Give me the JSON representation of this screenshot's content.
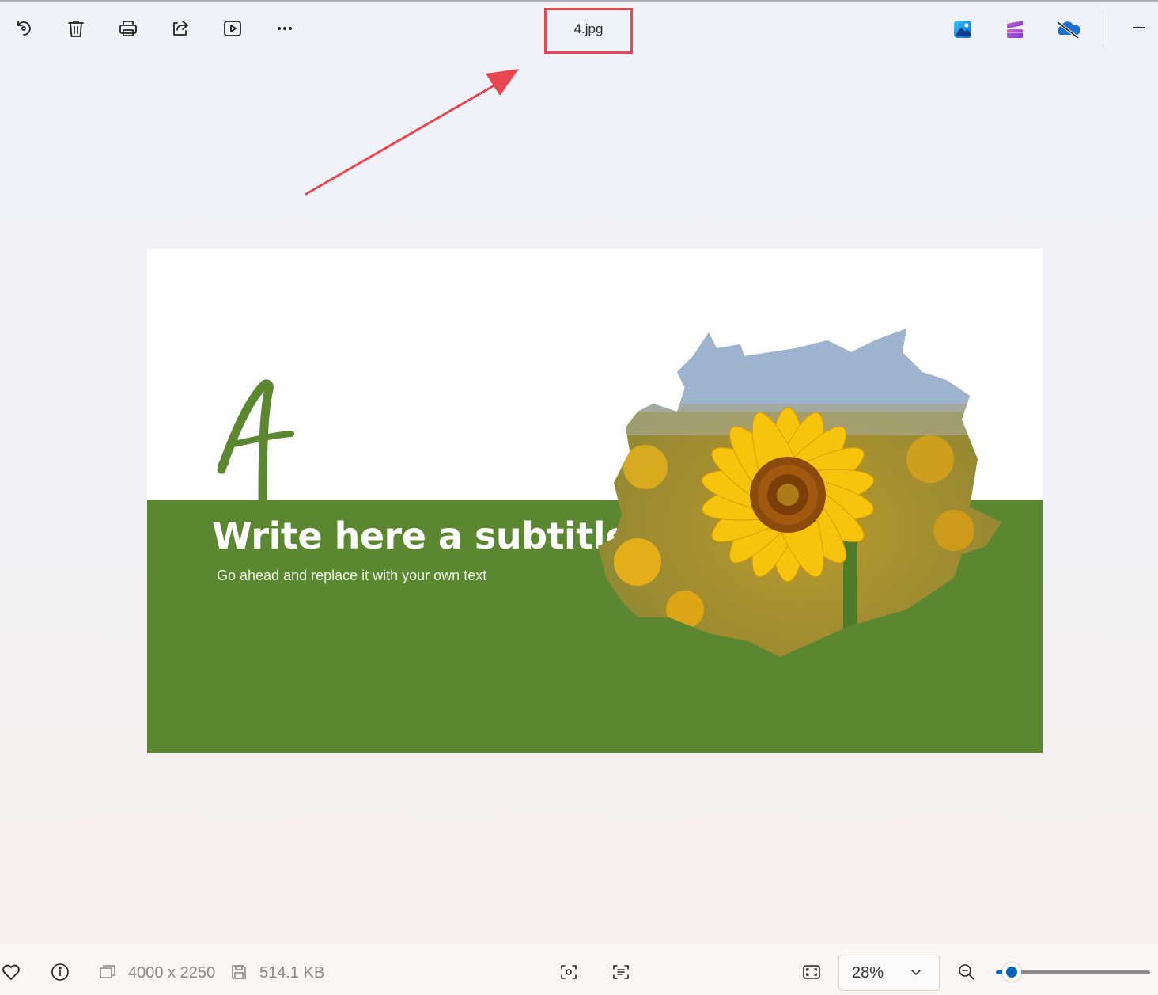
{
  "window": {
    "file_name": "4.jpg"
  },
  "toolbar": {
    "icons": [
      "rotate-icon",
      "delete-icon",
      "print-icon",
      "share-icon",
      "slideshow-icon",
      "more-icon"
    ]
  },
  "apps": [
    "photos-app-icon",
    "clipchamp-icon",
    "onedrive-icon"
  ],
  "slide": {
    "letter": "A",
    "title": "Write here a subtitle",
    "subtitle": "Go ahead and replace it with your own text",
    "accent_color": "#5b8731"
  },
  "annotation": {
    "box_color": "#e8474f",
    "arrow_color": "#e8474f"
  },
  "status": {
    "dimensions": "4000 x 2250",
    "file_size": "514.1 KB",
    "zoom": "28%",
    "zoom_level": 0.28
  }
}
